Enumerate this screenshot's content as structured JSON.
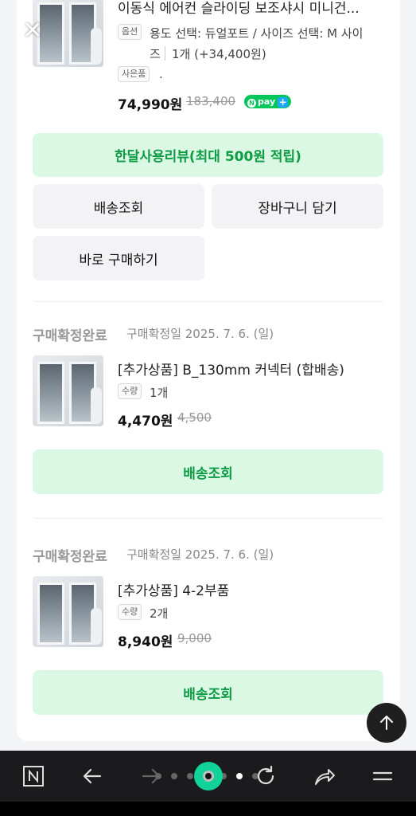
{
  "close_icon": "close-icon",
  "order1": {
    "title": "이동식 에어컨 슬라이딩 보조샤시 미니건...",
    "option_tag": "옵션",
    "option_line1": "용도 선택: 듀얼포트 / 사이즈 선택: M 사이",
    "option_line2": "즈",
    "option_qty": "1개 (+34,400원)",
    "gift_tag": "사은품",
    "gift_value": ".",
    "price": "74,990원",
    "original_price": "183,400",
    "npay_label": "pay",
    "review_button": "한달사용리뷰(최대 500원 적립)",
    "shipping_button": "배송조회",
    "cart_button": "장바구니 담기",
    "buy_button": "바로 구매하기"
  },
  "order2": {
    "status": "구매확정완료",
    "status_date": "구매확정일 2025. 7. 6. (일)",
    "title": "[추가상품] B_130mm 커넥터 (합배송)",
    "qty_tag": "수량",
    "qty": "1개",
    "price": "4,470원",
    "original_price": "4,500",
    "shipping_button": "배송조회"
  },
  "order3": {
    "status": "구매확정완료",
    "status_date": "구매확정일 2025. 7. 6. (일)",
    "title": "[추가상품] 4-2부품",
    "qty_tag": "수량",
    "qty": "2개",
    "price": "8,940원",
    "original_price": "9,000",
    "shipping_button": "배송조회"
  },
  "colors": {
    "accent_green": "#0d9b43",
    "green_button_bg": "#dbf8e5",
    "npay_green": "#03c75a",
    "navbar_bg": "#1b1b1d"
  },
  "navbar": {
    "icons": [
      "naver-n-icon",
      "back-arrow-icon",
      "forward-arrow-icon",
      "center-home-icon",
      "refresh-icon",
      "share-icon",
      "menu-icon"
    ]
  }
}
